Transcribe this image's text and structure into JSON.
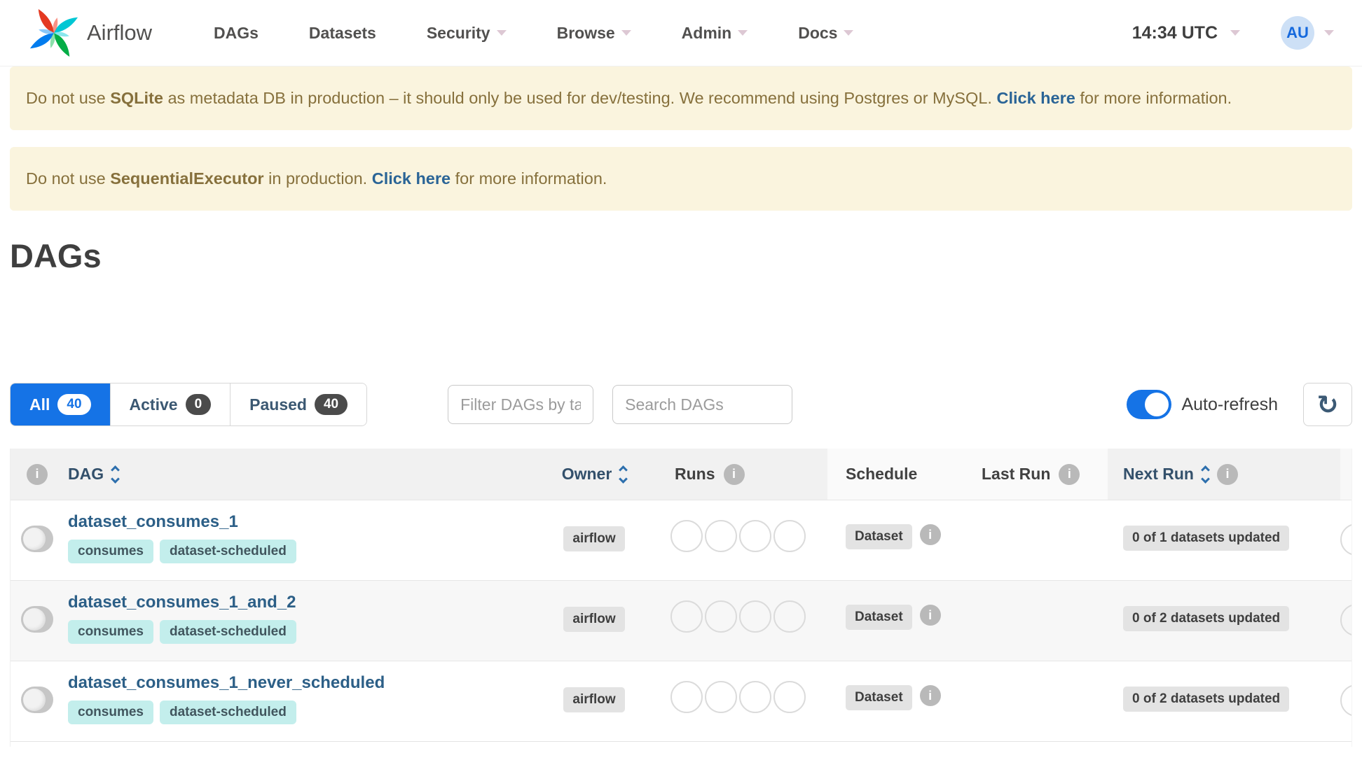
{
  "nav": {
    "brand": "Airflow",
    "items": [
      {
        "label": "DAGs"
      },
      {
        "label": "Datasets"
      },
      {
        "label": "Security"
      },
      {
        "label": "Browse"
      },
      {
        "label": "Admin"
      },
      {
        "label": "Docs"
      }
    ],
    "clock": "14:34 UTC",
    "avatar": "AU"
  },
  "banners": [
    {
      "pre": "Do not use ",
      "strong": "SQLite",
      "mid": " as metadata DB in production – it should only be used for dev/testing. We recommend using Postgres or MySQL. ",
      "link": "Click here",
      "post": " for more information."
    },
    {
      "pre": "Do not use ",
      "strong": "SequentialExecutor",
      "mid": " in production. ",
      "link": "Click here",
      "post": " for more information."
    }
  ],
  "page": {
    "title": "DAGs"
  },
  "filters": {
    "tabs": [
      {
        "label": "All",
        "count": "40"
      },
      {
        "label": "Active",
        "count": "0"
      },
      {
        "label": "Paused",
        "count": "40"
      }
    ],
    "tag_placeholder": "Filter DAGs by tag",
    "search_placeholder": "Search DAGs",
    "autorefresh_label": "Auto-refresh"
  },
  "icons": {
    "refresh": "↻",
    "info": "i"
  },
  "table": {
    "headers": {
      "dag": "DAG",
      "owner": "Owner",
      "runs": "Runs",
      "schedule": "Schedule",
      "last_run": "Last Run",
      "next_run": "Next Run"
    },
    "rows": [
      {
        "name": "dataset_consumes_1",
        "tags": [
          "consumes",
          "dataset-scheduled"
        ],
        "owner": "airflow",
        "schedule": "Dataset",
        "next_run": "0 of 1 datasets updated"
      },
      {
        "name": "dataset_consumes_1_and_2",
        "tags": [
          "consumes",
          "dataset-scheduled"
        ],
        "owner": "airflow",
        "schedule": "Dataset",
        "next_run": "0 of 2 datasets updated"
      },
      {
        "name": "dataset_consumes_1_never_scheduled",
        "tags": [
          "consumes",
          "dataset-scheduled"
        ],
        "owner": "airflow",
        "schedule": "Dataset",
        "next_run": "0 of 2 datasets updated"
      }
    ]
  },
  "colors": {
    "accent_blue": "#1573e6",
    "banner_bg": "#faf4de",
    "banner_text": "#86703c",
    "link_blue": "#2a6496",
    "tag_bg": "#c3eeec"
  }
}
